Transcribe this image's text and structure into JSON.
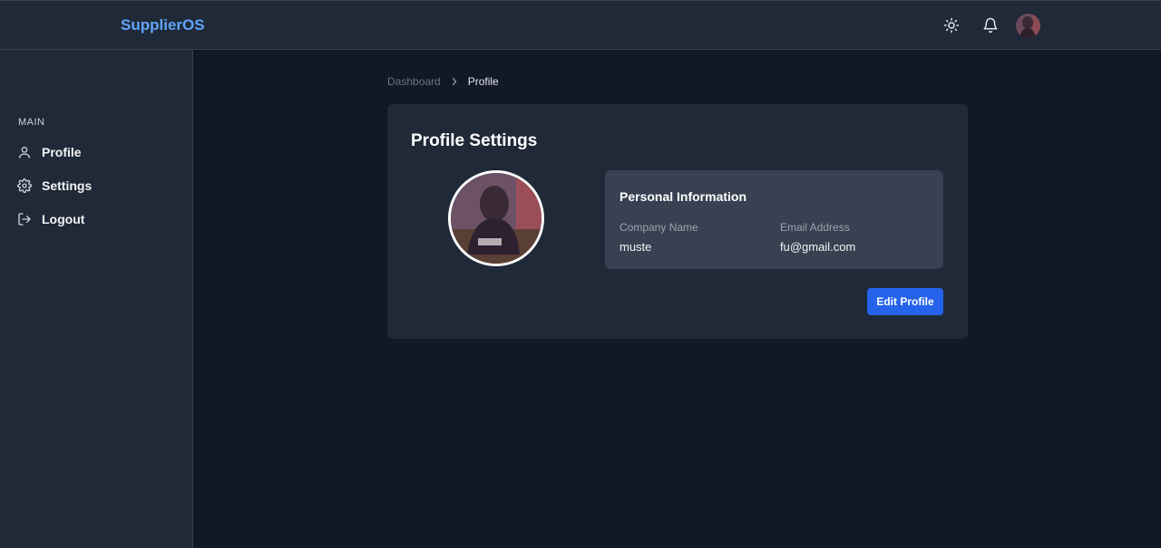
{
  "app": {
    "brand": "SupplierOS",
    "accent_color": "#60a5fa",
    "primary_button_color": "#2563eb"
  },
  "header": {
    "icons": [
      "sun-icon",
      "bell-icon"
    ],
    "avatar": "user-avatar"
  },
  "sidebar": {
    "section_label": "MAIN",
    "items": [
      {
        "label": "Profile",
        "icon": "user-icon"
      },
      {
        "label": "Settings",
        "icon": "gear-icon"
      },
      {
        "label": "Logout",
        "icon": "logout-icon"
      }
    ]
  },
  "breadcrumb": {
    "parent": "Dashboard",
    "current": "Profile"
  },
  "profile": {
    "title": "Profile Settings",
    "info_title": "Personal Information",
    "company_label": "Company Name",
    "company_value": "muste",
    "email_label": "Email Address",
    "email_value": "fu@gmail.com",
    "edit_button": "Edit Profile"
  }
}
